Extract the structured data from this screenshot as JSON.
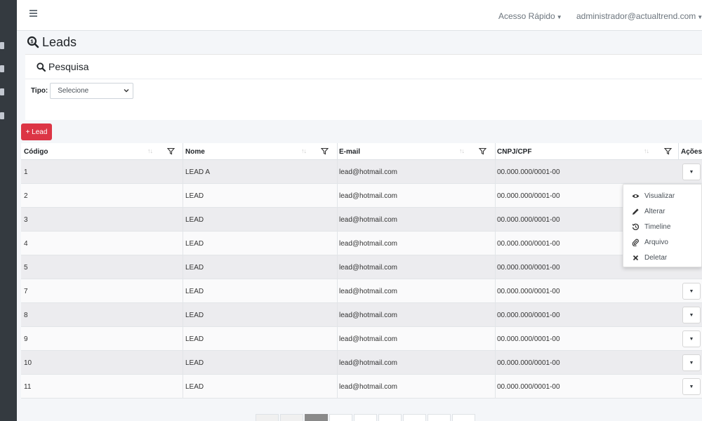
{
  "topbar": {
    "quick_access": "Acesso Rápido",
    "user": "administrador@actualtrend.com"
  },
  "page": {
    "title": "Leads"
  },
  "search": {
    "header": "Pesquisa",
    "tipo_label": "Tipo:",
    "tipo_value": "Selecione"
  },
  "actions": {
    "add_lead": "+ Lead"
  },
  "table": {
    "columns": [
      "Código",
      "Nome",
      "E-mail",
      "CNPJ/CPF",
      "Ações"
    ],
    "rows": [
      {
        "codigo": "1",
        "nome": "LEAD A",
        "email": "lead@hotmail.com",
        "cnpj": "00.000.000/0001-00"
      },
      {
        "codigo": "2",
        "nome": "LEAD",
        "email": "lead@hotmail.com",
        "cnpj": "00.000.000/0001-00"
      },
      {
        "codigo": "3",
        "nome": "LEAD",
        "email": "lead@hotmail.com",
        "cnpj": "00.000.000/0001-00"
      },
      {
        "codigo": "4",
        "nome": "LEAD",
        "email": "lead@hotmail.com",
        "cnpj": "00.000.000/0001-00"
      },
      {
        "codigo": "5",
        "nome": "LEAD",
        "email": "lead@hotmail.com",
        "cnpj": "00.000.000/0001-00"
      },
      {
        "codigo": "7",
        "nome": "LEAD",
        "email": "lead@hotmail.com",
        "cnpj": "00.000.000/0001-00"
      },
      {
        "codigo": "8",
        "nome": "LEAD",
        "email": "lead@hotmail.com",
        "cnpj": "00.000.000/0001-00"
      },
      {
        "codigo": "9",
        "nome": "LEAD",
        "email": "lead@hotmail.com",
        "cnpj": "00.000.000/0001-00"
      },
      {
        "codigo": "10",
        "nome": "LEAD",
        "email": "lead@hotmail.com",
        "cnpj": "00.000.000/0001-00"
      },
      {
        "codigo": "11",
        "nome": "LEAD",
        "email": "lead@hotmail.com",
        "cnpj": "00.000.000/0001-00"
      }
    ]
  },
  "dropdown": {
    "items": [
      {
        "label": "Visualizar",
        "icon": "eye-icon"
      },
      {
        "label": "Alterar",
        "icon": "pencil-icon"
      },
      {
        "label": "Timeline",
        "icon": "history-icon"
      },
      {
        "label": "Arquivo",
        "icon": "paperclip-icon"
      },
      {
        "label": "Deletar",
        "icon": "close-icon"
      }
    ]
  },
  "colors": {
    "sidebar": "#343a40",
    "danger": "#dc3545",
    "pagination_active": "#8a8a8a"
  }
}
